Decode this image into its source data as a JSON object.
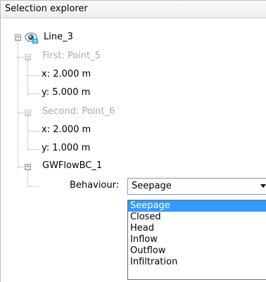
{
  "panel": {
    "title": "Selection explorer"
  },
  "tree": {
    "root": {
      "label": "Line_3",
      "icon": "eye-icon",
      "toggle": "−"
    },
    "first": {
      "label": "First: Point_5",
      "toggle": "−",
      "x": "x: 2.000 m",
      "y": "y: 5.000 m"
    },
    "second": {
      "label": "Second: Point_6",
      "toggle": "−",
      "x": "x: 2.000 m",
      "y": "y: 1.000 m"
    },
    "gwflow": {
      "label": "GWFlowBC_1",
      "toggle": "−",
      "behaviour_label": "Behaviour:"
    }
  },
  "behaviour_select": {
    "value": "Seepage",
    "options": [
      "Seepage",
      "Closed",
      "Head",
      "Inflow",
      "Outflow",
      "Infiltration"
    ],
    "selected_index": 0
  },
  "colors": {
    "selection": "#3399ff",
    "muted_text": "#a9a9a9"
  }
}
